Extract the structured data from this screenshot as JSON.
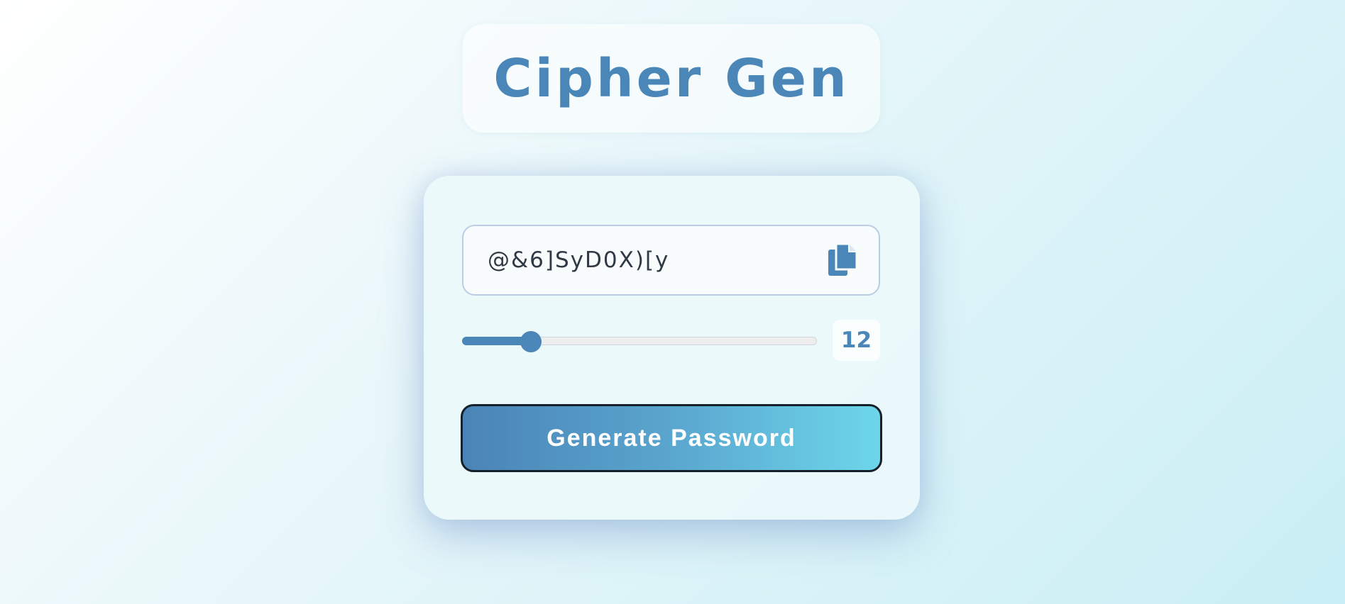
{
  "app": {
    "title": "Cipher Gen"
  },
  "generator": {
    "password_value": "@&6]SyD0X)[y",
    "length_value": "12",
    "length_fraction": 0.194,
    "copy_icon": "copy-icon",
    "generate_label": "Generate Password"
  },
  "colors": {
    "accent": "#4a86b8",
    "button_gradient_start": "#4a84b6",
    "button_gradient_end": "#6dd6ea"
  }
}
